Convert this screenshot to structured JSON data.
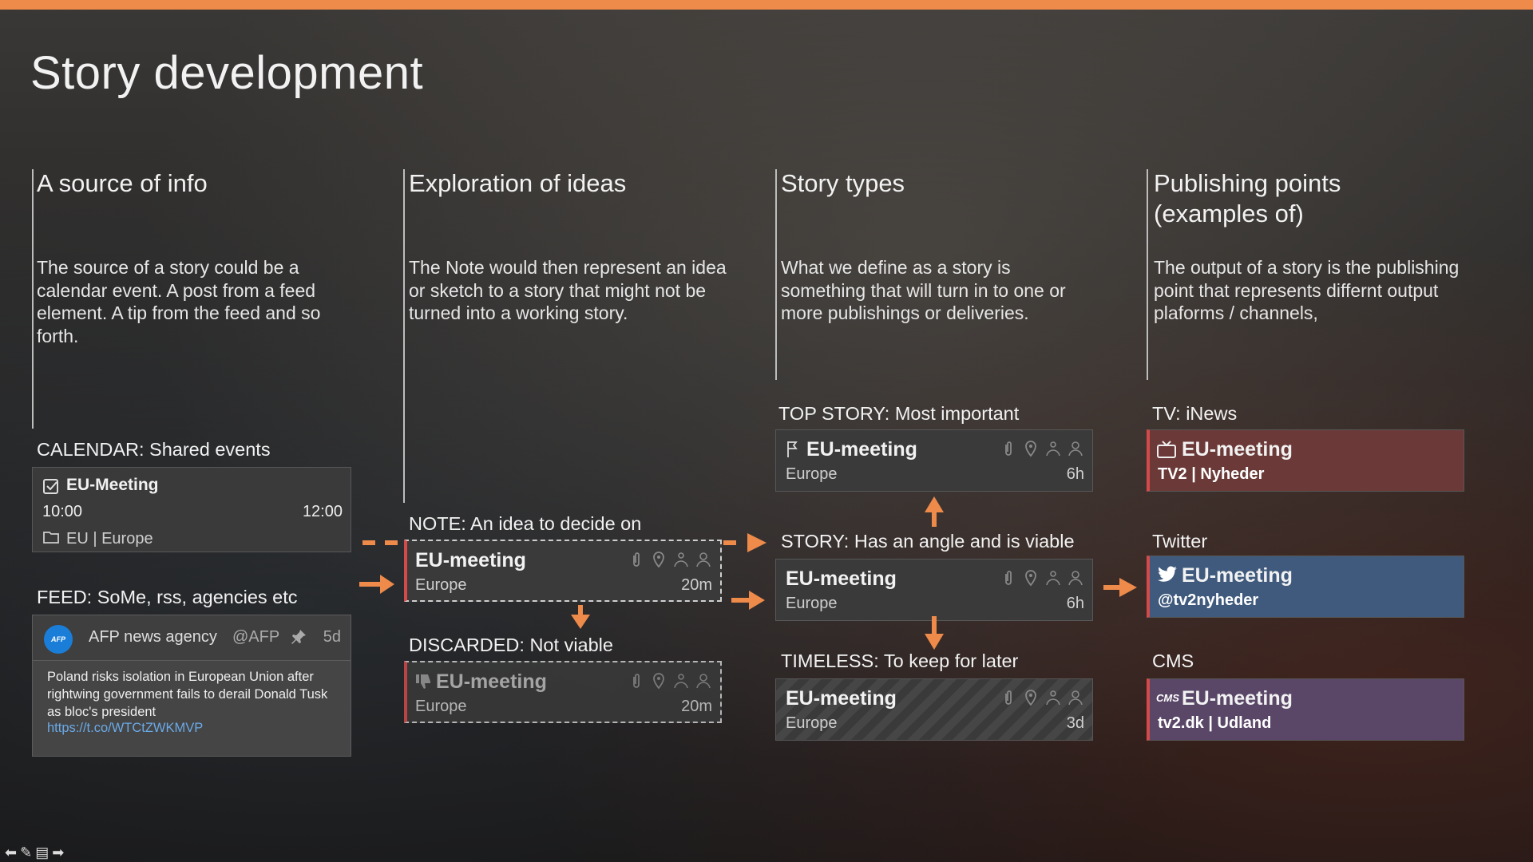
{
  "title": "Story development",
  "columns": [
    {
      "heading": "A source of info",
      "heading2": "",
      "desc": "The source of a story could be a calendar event. A post from a feed element. A tip from the feed and so forth."
    },
    {
      "heading": "Exploration of ideas",
      "heading2": "",
      "desc": "The Note would then represent an idea or sketch to a story that might not be turned into a working story."
    },
    {
      "heading": "Story types",
      "heading2": "",
      "desc": "What we define as a story is something that will turn in to one or more publishings or deliveries."
    },
    {
      "heading": "Publishing points",
      "heading2": "(examples of)",
      "desc": "The output of a story is the publishing point that represents differnt output plaforms / channels,"
    }
  ],
  "calendar": {
    "label": "CALENDAR: Shared events",
    "title": "EU-Meeting",
    "start": "10:00",
    "end": "12:00",
    "folder": "EU | Europe"
  },
  "feed": {
    "label": "FEED: SoMe, rss, agencies etc",
    "agency": "AFP news agency",
    "handle": "@AFP",
    "age": "5d",
    "logo": "AFP",
    "text": "Poland risks isolation in European Union after rightwing government fails to derail Donald Tusk as bloc's president",
    "link": "https://t.co/WTCtZWKMVP"
  },
  "note": {
    "label": "NOTE: An idea to decide on",
    "title": "EU-meeting",
    "sub": "Europe",
    "age": "20m"
  },
  "discarded": {
    "label": "DISCARDED: Not viable",
    "title": "EU-meeting",
    "sub": "Europe",
    "age": "20m"
  },
  "top_story": {
    "label": "TOP STORY: Most important",
    "title": "EU-meeting",
    "sub": "Europe",
    "age": "6h"
  },
  "story": {
    "label": "STORY: Has an angle and is viable",
    "title": "EU-meeting",
    "sub": "Europe",
    "age": "6h"
  },
  "timeless": {
    "label": "TIMELESS: To keep for later",
    "title": "EU-meeting",
    "sub": "Europe",
    "age": "3d"
  },
  "tv": {
    "label": "TV: iNews",
    "title": "EU-meeting",
    "sub": "TV2 | Nyheder",
    "color": "#6b3a38"
  },
  "twitter": {
    "label": "Twitter",
    "title": "EU-meeting",
    "sub": "@tv2nyheder",
    "color": "#3f5a7d"
  },
  "cms": {
    "label": "CMS",
    "title": "EU-meeting",
    "sub": "tv2.dk | Udland",
    "badge": "CMS",
    "color": "#5a4768"
  },
  "colors": {
    "accent": "#ee8a4a",
    "red": "#d34a4a"
  }
}
